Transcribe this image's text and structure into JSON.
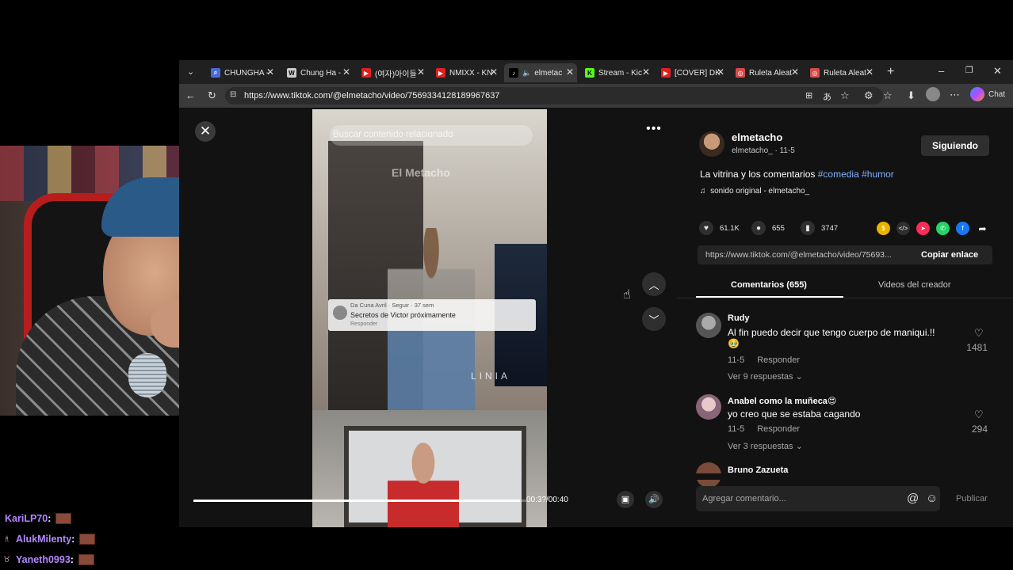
{
  "browser": {
    "tabs": [
      {
        "label": "CHUNGHA -",
        "icon": "search-icon",
        "color": "#4a6ad8"
      },
      {
        "label": "Chung Ha -",
        "icon": "wikipedia-icon",
        "color": "#cccccc"
      },
      {
        "label": "(여자)아이들",
        "icon": "youtube-icon",
        "color": "#e02020"
      },
      {
        "label": "NMIXX - KN",
        "icon": "youtube-icon",
        "color": "#e02020"
      },
      {
        "label": "elmetac",
        "icon": "tiktok-icon",
        "color": "#000000",
        "active": true
      },
      {
        "label": "Stream - Kic",
        "icon": "kick-icon",
        "color": "#53fc18"
      },
      {
        "label": "[COVER] DK",
        "icon": "youtube-icon",
        "color": "#e02020"
      },
      {
        "label": "Ruleta Aleat",
        "icon": "wheel-icon",
        "color": "#d84a4a"
      },
      {
        "label": "Ruleta Aleat",
        "icon": "wheel-icon",
        "color": "#d84a4a"
      }
    ],
    "url": "https://www.tiktok.com/@elmetacho/video/7569334128189967637",
    "chat_label": "Chat"
  },
  "video": {
    "search_placeholder": "Buscar contenido relacionado",
    "watermark": "El Metacho",
    "overlay_comment": {
      "name": "Da Cuna Avril · Seguir · 37 sem",
      "text": "Secretos de Victor próximamente",
      "reply": "Responder"
    },
    "store_sign": "LINIA",
    "progress_fraction": 0.98,
    "time": "00:3?/00:40"
  },
  "panel": {
    "author_name": "elmetacho",
    "author_sub": "elmetacho_ · 11-5",
    "follow_label": "Siguiendo",
    "description_text": "La vitrina y los comentarios ",
    "hashtags": [
      "#comedia",
      "#humor"
    ],
    "sound": "sonido original - elmetacho_",
    "stats": {
      "likes": "61.1K",
      "comments": "655",
      "saves": "3747"
    },
    "share_url": "https://www.tiktok.com/@elmetacho/video/75693...",
    "copy_label": "Copiar enlace",
    "tab_comments": "Comentarios (655)",
    "tab_videos": "Videos del creador",
    "comments": [
      {
        "name": "Rudy",
        "text": "Al fin puedo decir que tengo cuerpo de maniqui.!!",
        "emoji": "🥹",
        "date": "11-5",
        "reply": "Responder",
        "more": "Ver 9 respuestas ⌄",
        "likes": "1481"
      },
      {
        "name": "Anabel como la muñeca😍",
        "text": "yo creo que se estaba cagando",
        "date": "11-5",
        "reply": "Responder",
        "more": "Ver 3 respuestas ⌄",
        "likes": "294"
      },
      {
        "name": "Bruno Zazueta"
      }
    ],
    "add_comment_placeholder": "Agregar comentario...",
    "publish_label": "Publicar"
  },
  "chat": [
    {
      "name": "KariLP70",
      "sep": " :"
    },
    {
      "name": "AlukMilenty",
      "sep": " :"
    },
    {
      "name": "Yaneth0993",
      "sep": " :"
    }
  ]
}
